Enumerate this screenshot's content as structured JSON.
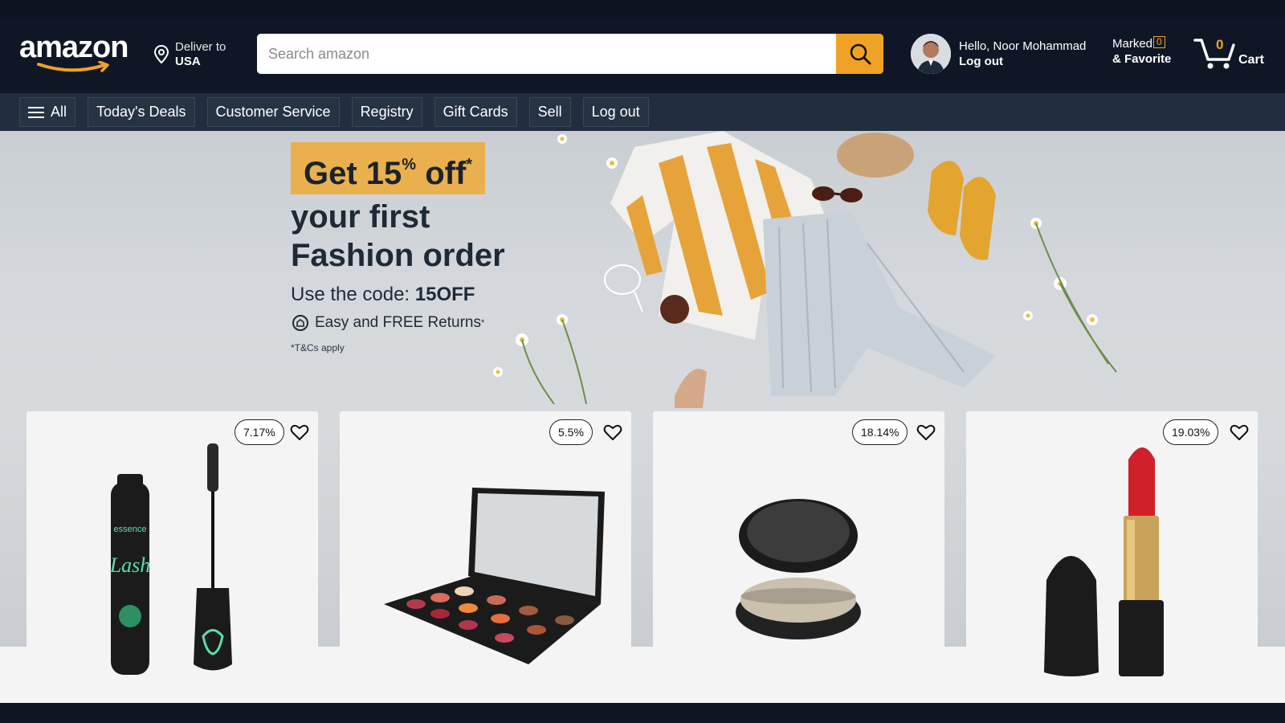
{
  "header": {
    "logo_text": "amazon",
    "deliver_line1": "Deliver to",
    "deliver_line2": "USA",
    "search_placeholder": "Search amazon",
    "account_hello": "Hello, Noor Mohammad",
    "account_logout": "Log out",
    "marked_line1": "Marked",
    "marked_count": "0",
    "marked_line2": "& Favorite",
    "cart_count": "0",
    "cart_label": "Cart"
  },
  "nav": {
    "items": [
      {
        "label": "All",
        "icon": "menu-icon"
      },
      {
        "label": "Today's Deals"
      },
      {
        "label": "Customer Service"
      },
      {
        "label": "Registry"
      },
      {
        "label": "Gift Cards"
      },
      {
        "label": "Sell"
      },
      {
        "label": "Log out"
      }
    ]
  },
  "hero": {
    "tag_main": "Get 15",
    "tag_sup": "%",
    "tag_off": " off",
    "tag_star": "*",
    "line1": "your first",
    "line2": "Fashion order",
    "code_prefix": "Use the code: ",
    "code": "15OFF",
    "returns": "Easy and FREE Returns",
    "returns_star": "*",
    "terms": "*T&Cs apply"
  },
  "products": [
    {
      "discount": "7.17%",
      "image": "mascara-product"
    },
    {
      "discount": "5.5%",
      "image": "eyeshadow-palette-product"
    },
    {
      "discount": "18.14%",
      "image": "compact-powder-product"
    },
    {
      "discount": "19.03%",
      "image": "lipstick-product"
    }
  ],
  "colors": {
    "header_bg": "#0f1726",
    "nav_bg": "#222e3d",
    "accent": "#f0a226",
    "promo_tag": "#eab04d"
  }
}
